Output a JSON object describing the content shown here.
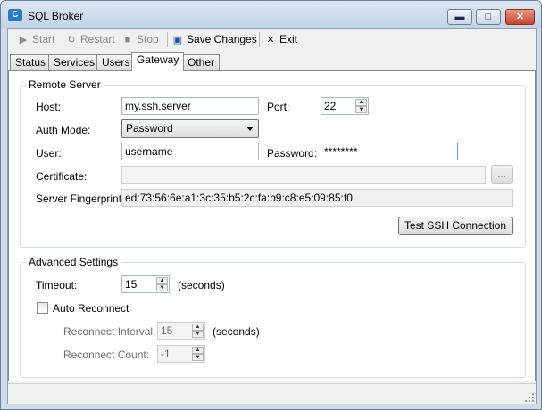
{
  "window": {
    "title": "SQL Broker",
    "icon": "app-icon"
  },
  "window_controls": {
    "minimize": "▬",
    "maximize": "□",
    "close": "✕"
  },
  "toolbar": {
    "start": "Start",
    "restart": "Restart",
    "stop": "Stop",
    "save": "Save Changes",
    "exit": "Exit"
  },
  "tabs": [
    "Status",
    "Services",
    "Users",
    "Gateway",
    "Other"
  ],
  "active_tab": "Gateway",
  "remote_server": {
    "title": "Remote Server",
    "host_label": "Host:",
    "host_value": "my.ssh.server",
    "port_label": "Port:",
    "port_value": "22",
    "auth_label": "Auth Mode:",
    "auth_value": "Password",
    "user_label": "User:",
    "user_value": "username",
    "password_label": "Password:",
    "password_value": "********",
    "cert_label": "Certificate:",
    "browse_label": "...",
    "fingerprint_label": "Server Fingerprint:",
    "fingerprint_value": "ed:73:56:6e:a1:3c:35:b5:2c:fa:b9:c8:e5:09:85:f0",
    "test_button": "Test SSH Connection"
  },
  "advanced": {
    "title": "Advanced Settings",
    "timeout_label": "Timeout:",
    "timeout_value": "15",
    "timeout_unit": "(seconds)",
    "auto_reconnect_label": "Auto Reconnect",
    "auto_reconnect_checked": false,
    "interval_label": "Reconnect Interval:",
    "interval_value": "15",
    "interval_unit": "(seconds)",
    "count_label": "Reconnect Count:",
    "count_value": "-1"
  }
}
